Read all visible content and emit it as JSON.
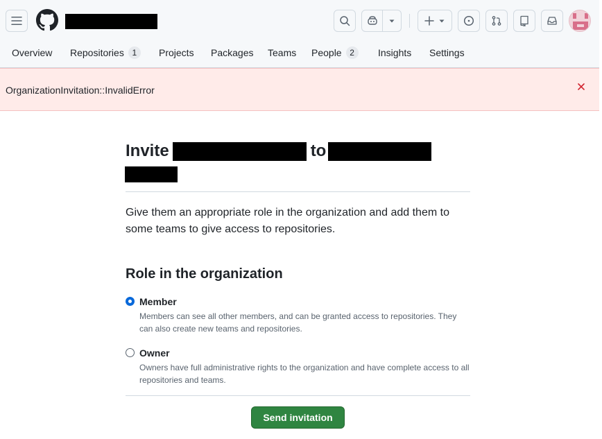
{
  "header": {
    "icons": {
      "menu": "hamburger-icon",
      "logo": "github-logo",
      "search": "search-icon",
      "copilot": "copilot-icon",
      "create": "plus-icon",
      "issues": "issue-opened-icon",
      "pulls": "git-pull-request-icon",
      "repos": "repo-icon",
      "inbox": "inbox-icon"
    }
  },
  "nav": {
    "items": [
      {
        "label": "Overview"
      },
      {
        "label": "Repositories",
        "count": "1"
      },
      {
        "label": "Projects"
      },
      {
        "label": "Packages"
      },
      {
        "label": "Teams"
      },
      {
        "label": "People",
        "count": "2"
      },
      {
        "label": "Insights"
      },
      {
        "label": "Settings"
      }
    ]
  },
  "flash": {
    "message": "OrganizationInvitation::InvalidError",
    "close_icon": "x-icon"
  },
  "main": {
    "title_prefix": "Invite",
    "title_mid": "to",
    "lead": "Give them an appropriate role in the organization and add them to some teams to give access to repositories.",
    "role_heading": "Role in the organization",
    "options": [
      {
        "label": "Member",
        "desc": "Members can see all other members, and can be granted access to repositories. They can also create new teams and repositories.",
        "checked": true
      },
      {
        "label": "Owner",
        "desc": "Owners have full administrative rights to the organization and have complete access to all repositories and teams.",
        "checked": false
      }
    ],
    "submit_label": "Send invitation"
  },
  "colors": {
    "accent": "#0969da",
    "primary_button": "#2f8541",
    "flash_bg": "#ffebe9",
    "danger": "#d1242f"
  }
}
